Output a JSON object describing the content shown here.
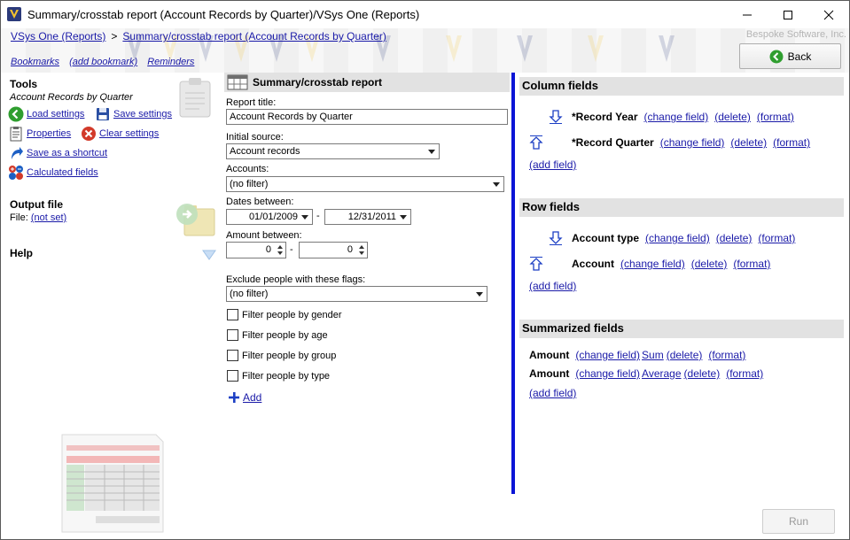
{
  "window": {
    "title": "Summary/crosstab report (Account Records by Quarter)/VSys One (Reports)"
  },
  "header": {
    "breadcrumb_root": "VSys One (Reports)",
    "breadcrumb_sep": ">",
    "breadcrumb_current": "Summary/crosstab report (Account Records by Quarter)",
    "vendor": "Bespoke Software, Inc.",
    "back_label": "Back",
    "bookmarks": "Bookmarks",
    "add_bookmark": "(add bookmark)",
    "reminders": "Reminders"
  },
  "left": {
    "tools_title": "Tools",
    "report_name": "Account Records by Quarter",
    "load_settings": "Load settings",
    "save_settings": "Save settings",
    "properties": "Properties",
    "clear_settings": "Clear settings",
    "save_shortcut": "Save as a shortcut",
    "calculated_fields": "Calculated fields",
    "output_title": "Output file",
    "file_label": "File:",
    "file_value": "(not set)",
    "help_title": "Help"
  },
  "form": {
    "panel_title": "Summary/crosstab report",
    "report_title_label": "Report title:",
    "report_title_value": "Account Records by Quarter",
    "initial_source_label": "Initial source:",
    "initial_source_value": "Account records",
    "accounts_label": "Accounts:",
    "accounts_value": "(no filter)",
    "dates_label": "Dates between:",
    "date_from": "01/01/2009",
    "date_sep": "-",
    "date_to": "12/31/2011",
    "amount_label": "Amount between:",
    "amount_from": "0",
    "amount_sep": "-",
    "amount_to": "0",
    "exclude_label": "Exclude people with these flags:",
    "exclude_value": "(no filter)",
    "filter_gender": "Filter people by gender",
    "filter_age": "Filter people by age",
    "filter_group": "Filter people by group",
    "filter_type": "Filter people by type",
    "add_label": "Add"
  },
  "fields": {
    "column_title": "Column fields",
    "column_1": "*Record Year",
    "column_2": "*Record Quarter",
    "row_title": "Row fields",
    "row_1": "Account type",
    "row_2": "Account",
    "summ_title": "Summarized fields",
    "summ_1": "Amount",
    "summ_1_fn": "Sum",
    "summ_2": "Amount",
    "summ_2_fn": "Average",
    "change_field": "(change field)",
    "delete": "(delete)",
    "format": "(format)",
    "add_field": "(add field)"
  },
  "run_label": "Run",
  "colors": {
    "link": "#1a1aa8",
    "divider": "#0b15d6",
    "section_bg": "#e2e2e2"
  }
}
